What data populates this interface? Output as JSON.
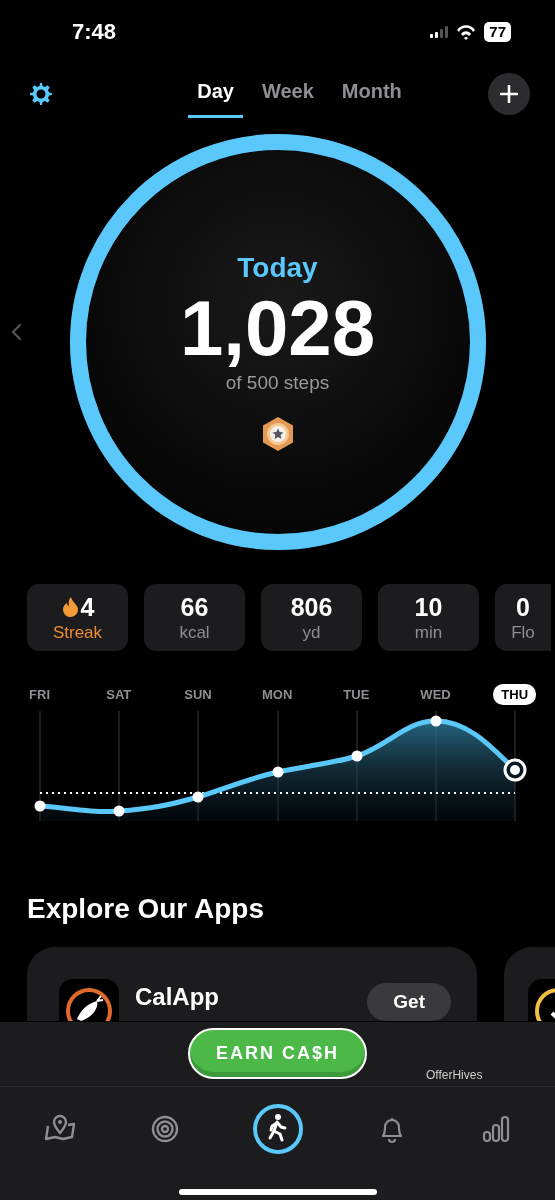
{
  "status_bar": {
    "time": "7:48",
    "battery": "77"
  },
  "tabs": [
    {
      "label": "Day",
      "selected": true
    },
    {
      "label": "Week",
      "selected": false
    },
    {
      "label": "Month",
      "selected": false
    }
  ],
  "ring": {
    "title": "Today",
    "value": "1,028",
    "goal": "of 500 steps",
    "level": 1
  },
  "stats": [
    {
      "kind": "streak",
      "value": "4",
      "label": "Streak"
    },
    {
      "kind": "metric",
      "value": "66",
      "label": "kcal"
    },
    {
      "kind": "metric",
      "value": "806",
      "label": "yd"
    },
    {
      "kind": "metric",
      "value": "10",
      "label": "min"
    },
    {
      "kind": "metric",
      "value": "0",
      "label": "Flo"
    }
  ],
  "chart": {
    "days": [
      {
        "label": "FRI",
        "selected": false
      },
      {
        "label": "SAT",
        "selected": false
      },
      {
        "label": "SUN",
        "selected": false
      },
      {
        "label": "MON",
        "selected": false
      },
      {
        "label": "TUE",
        "selected": false
      },
      {
        "label": "WED",
        "selected": false
      },
      {
        "label": "THU",
        "selected": true
      }
    ]
  },
  "explore": {
    "title": "Explore Our Apps",
    "apps": [
      {
        "name": "CalApp",
        "button": "Get"
      }
    ]
  },
  "promo": {
    "button": "EARN CA$H",
    "sponsor": "OfferHives"
  },
  "tab_bar": [
    {
      "kind": "map",
      "selected": false
    },
    {
      "kind": "target",
      "selected": false
    },
    {
      "kind": "walk",
      "selected": true
    },
    {
      "kind": "bell",
      "selected": false
    },
    {
      "kind": "bars",
      "selected": false
    }
  ]
}
